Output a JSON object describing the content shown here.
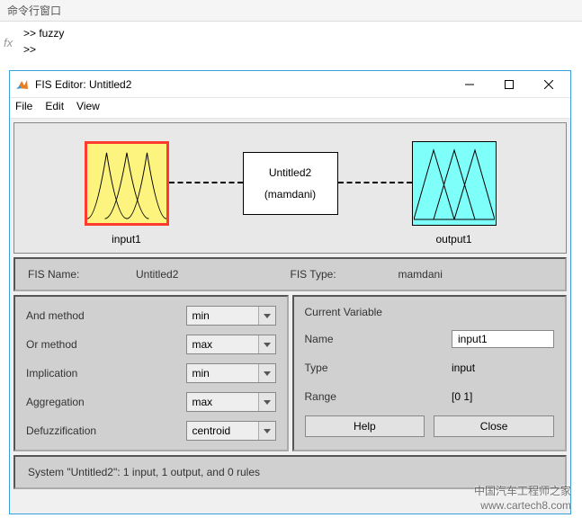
{
  "command": {
    "title": "命令行窗口",
    "lines": [
      ">> fuzzy",
      ">>"
    ],
    "fx": "fx"
  },
  "window": {
    "title": "FIS Editor: Untitled2"
  },
  "menu": {
    "file": "File",
    "edit": "Edit",
    "view": "View"
  },
  "diagram": {
    "input_label": "input1",
    "center_name": "Untitled2",
    "center_type": "(mamdani)",
    "output_label": "output1"
  },
  "fis": {
    "name_label": "FIS Name:",
    "name_value": "Untitled2",
    "type_label": "FIS Type:",
    "type_value": "mamdani"
  },
  "methods": {
    "and": {
      "label": "And method",
      "value": "min"
    },
    "or": {
      "label": "Or method",
      "value": "max"
    },
    "imp": {
      "label": "Implication",
      "value": "min"
    },
    "agg": {
      "label": "Aggregation",
      "value": "max"
    },
    "def": {
      "label": "Defuzzification",
      "value": "centroid"
    }
  },
  "current": {
    "heading": "Current Variable",
    "name_label": "Name",
    "name_value": "input1",
    "type_label": "Type",
    "type_value": "input",
    "range_label": "Range",
    "range_value": "[0 1]",
    "help": "Help",
    "close": "Close"
  },
  "status": "System \"Untitled2\": 1 input, 1 output, and 0 rules",
  "watermark": {
    "zh": "中国汽车工程师之家",
    "en": "www.cartech8.com"
  }
}
